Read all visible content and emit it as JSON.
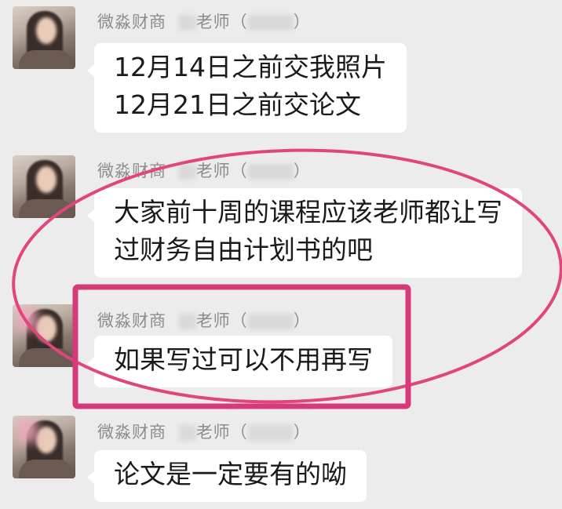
{
  "messages": [
    {
      "sender": {
        "name": "微淼财商",
        "teacher": "老师（",
        "close": "）"
      },
      "lines": [
        "12月14日之前交我照片",
        "12月21日之前交论文"
      ]
    },
    {
      "sender": {
        "name": "微淼财商",
        "teacher": "老师（",
        "close": "）"
      },
      "lines": [
        "大家前十周的课程应该老师都让写",
        "过财务自由计划书的吧"
      ]
    },
    {
      "sender": {
        "name": "微淼财商",
        "teacher": "老师（",
        "close": "）"
      },
      "lines": [
        "如果写过可以不用再写"
      ]
    },
    {
      "sender": {
        "name": "微淼财商",
        "teacher": "老师（",
        "close": "）"
      },
      "lines": [
        "论文是一定要有的呦"
      ]
    }
  ],
  "annotation_colors": {
    "ellipse": "#e0457b",
    "rectangle": "#d63a7a"
  }
}
